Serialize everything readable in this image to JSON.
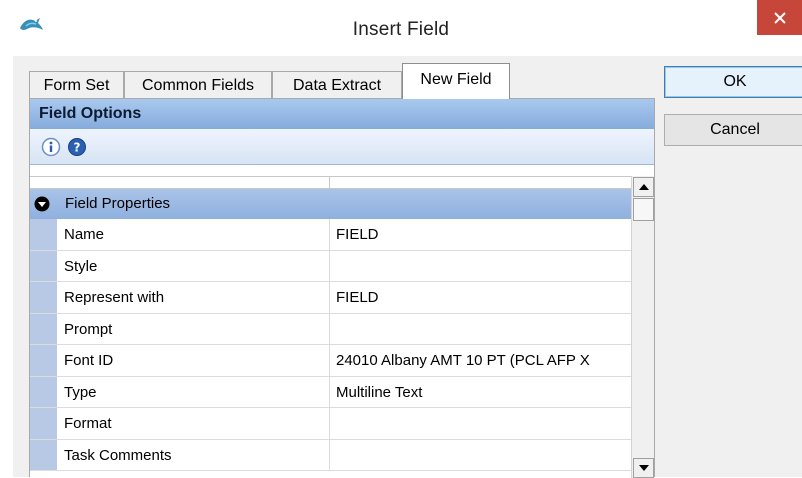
{
  "window": {
    "title": "Insert Field",
    "close_glyph": "✕",
    "icon": "app-bird-icon"
  },
  "tabs": [
    {
      "label": "Form Set",
      "active": false
    },
    {
      "label": "Common Fields",
      "active": false
    },
    {
      "label": "Data Extract",
      "active": false
    },
    {
      "label": "New Field",
      "active": true
    }
  ],
  "panel": {
    "header": "Field Options",
    "toolbar_icons": [
      "info-icon",
      "help-icon"
    ],
    "group": {
      "label": "Field Properties",
      "expanded": true,
      "rows": [
        {
          "name": "Name",
          "value": "FIELD"
        },
        {
          "name": "Style",
          "value": ""
        },
        {
          "name": "Represent with",
          "value": "FIELD"
        },
        {
          "name": "Prompt",
          "value": ""
        },
        {
          "name": "Font ID",
          "value": "24010 Albany AMT 10 PT (PCL AFP X"
        },
        {
          "name": "Type",
          "value": "Multiline Text"
        },
        {
          "name": "Format",
          "value": ""
        },
        {
          "name": "Task Comments",
          "value": ""
        }
      ]
    }
  },
  "buttons": {
    "ok": "OK",
    "cancel": "Cancel"
  },
  "colors": {
    "close_button": "#c7463a",
    "header_blue": "#86acdc",
    "gutter_blue": "#b7c9e4"
  }
}
